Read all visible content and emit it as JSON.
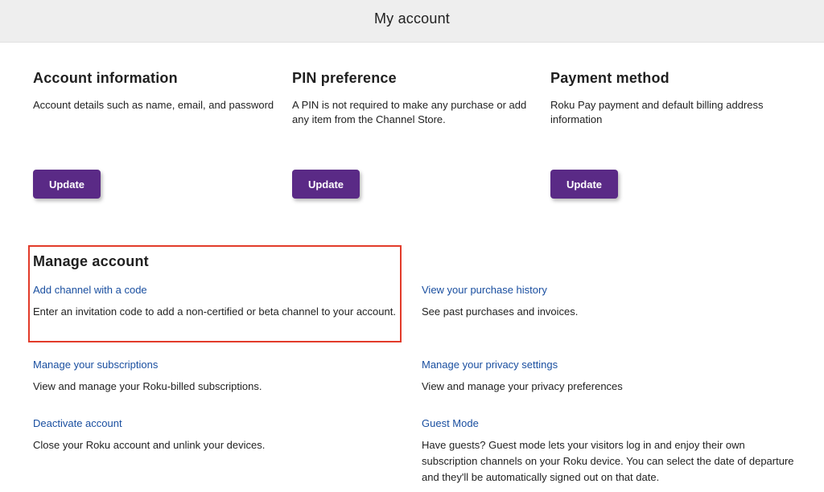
{
  "header": {
    "title": "My account"
  },
  "sections": [
    {
      "title": "Account information",
      "description": "Account details such as name, email, and password",
      "button_label": "Update"
    },
    {
      "title": "PIN preference",
      "description": "A PIN is not required to make any purchase or add any item from the Channel Store.",
      "button_label": "Update"
    },
    {
      "title": "Payment method",
      "description": "Roku Pay payment and default billing address information",
      "button_label": "Update"
    }
  ],
  "manage": {
    "title": "Manage account",
    "items": [
      {
        "link": "Add channel with a code",
        "description": "Enter an invitation code to add a non-certified or beta channel to your account."
      },
      {
        "link": "View your purchase history",
        "description": "See past purchases and invoices."
      },
      {
        "link": "Manage your subscriptions",
        "description": "View and manage your Roku-billed subscriptions."
      },
      {
        "link": "Manage your privacy settings",
        "description": "View and manage your privacy preferences"
      },
      {
        "link": "Deactivate account",
        "description": "Close your Roku account and unlink your devices."
      },
      {
        "link": "Guest Mode",
        "description": "Have guests? Guest mode lets your visitors log in and enjoy their own subscription channels on your Roku device. You can select the date of departure and they'll be automatically signed out on that date."
      }
    ]
  },
  "colors": {
    "button": "#5a2a86",
    "link": "#1a4fa0",
    "highlight": "#e23b2a",
    "header_bg": "#eeeeee"
  }
}
